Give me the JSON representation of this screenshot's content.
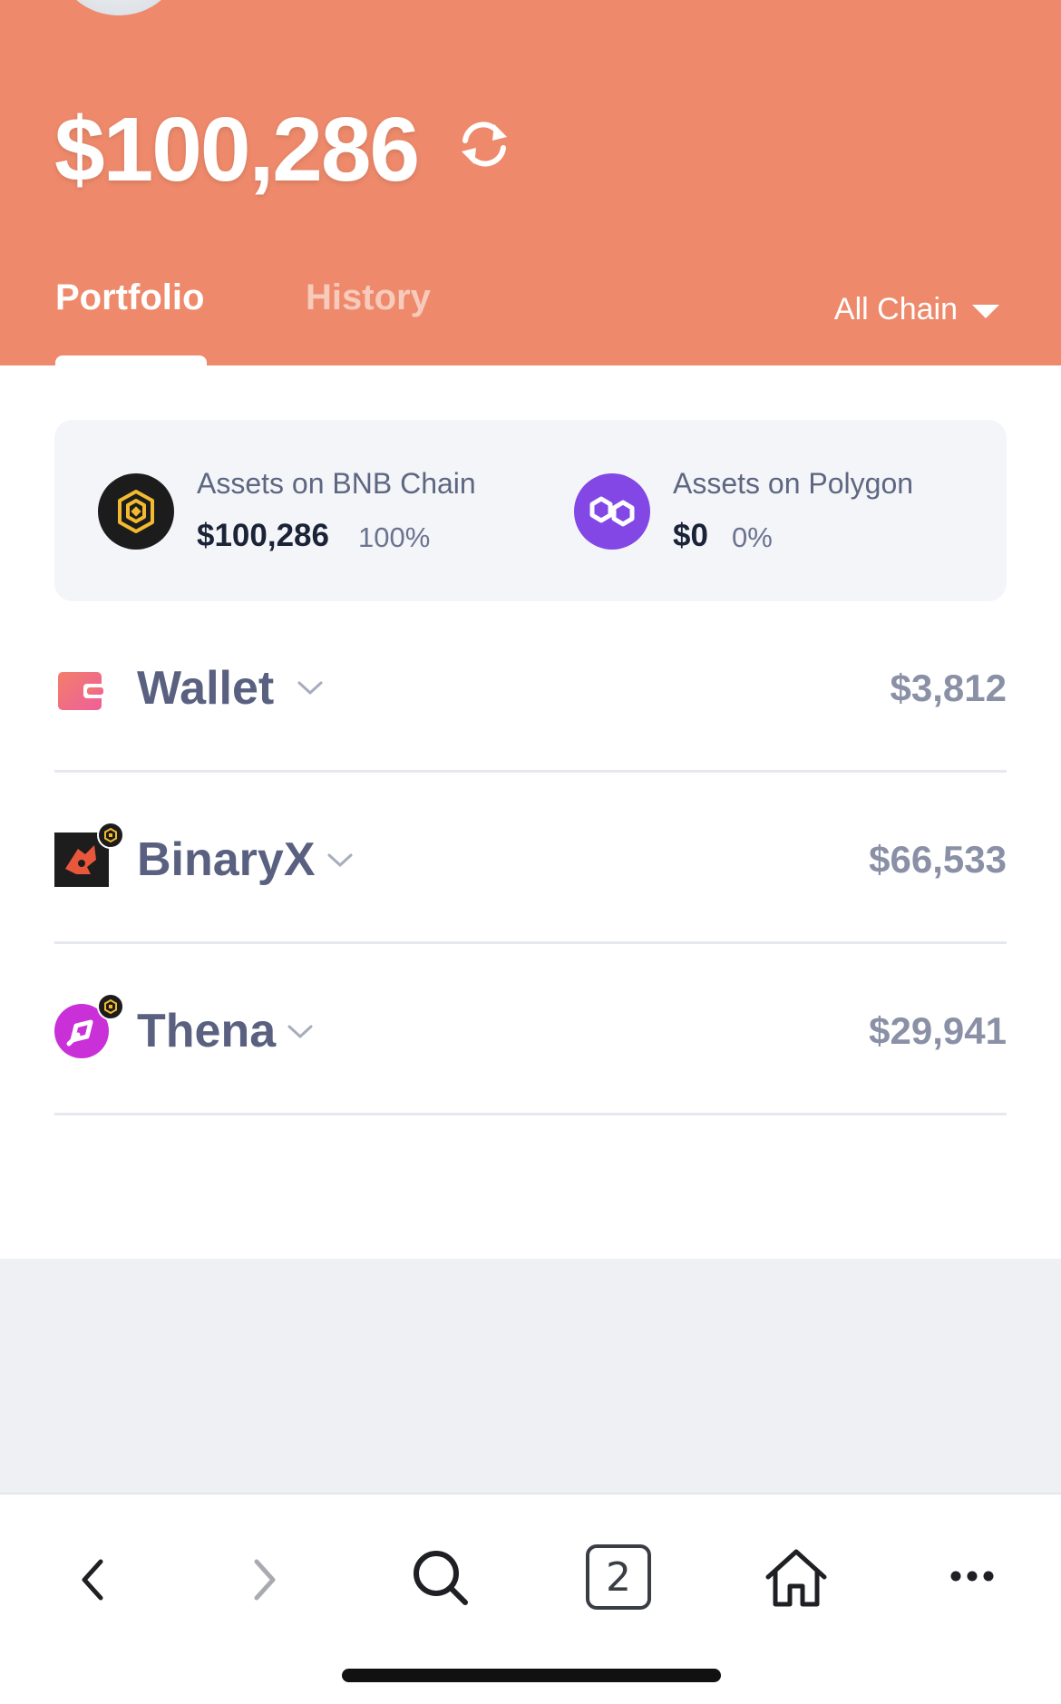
{
  "header": {
    "total_value": "$100,286",
    "tabs": [
      {
        "label": "Portfolio",
        "active": true
      },
      {
        "label": "History",
        "active": false
      }
    ],
    "chain_filter": "All Chain",
    "background_color": "#ee8a6b"
  },
  "chain_summary": [
    {
      "label": "Assets on BNB Chain",
      "value": "$100,286",
      "percent": "100%",
      "icon": "bnb-chain-icon"
    },
    {
      "label": "Assets on Polygon",
      "value": "$0",
      "percent": "0%",
      "icon": "polygon-icon"
    }
  ],
  "protocols": [
    {
      "name": "Wallet",
      "value": "$3,812",
      "icon": "wallet-icon"
    },
    {
      "name": "BinaryX",
      "value": "$66,533",
      "icon": "binaryx-icon"
    },
    {
      "name": "Thena",
      "value": "$29,941",
      "icon": "thena-icon"
    }
  ],
  "toolbar": {
    "tab_count": "2",
    "buttons": [
      "back-icon",
      "forward-icon",
      "search-icon",
      "tabs-icon",
      "home-icon",
      "more-icon"
    ]
  }
}
